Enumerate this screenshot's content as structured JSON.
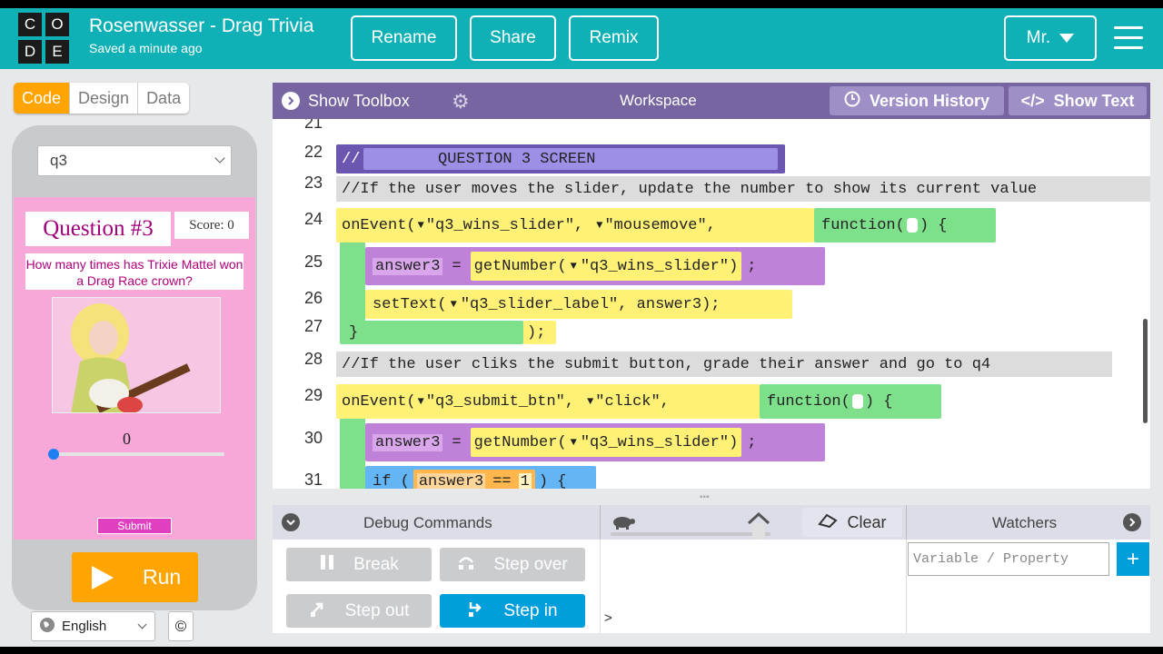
{
  "header": {
    "logo_letters": [
      "C",
      "O",
      "D",
      "E"
    ],
    "project_title": "Rosenwasser - Drag Trivia",
    "saved_status": "Saved a minute ago",
    "rename_label": "Rename",
    "share_label": "Share",
    "remix_label": "Remix",
    "user_label": "Mr.",
    "menu_icon": "hamburger-menu-icon"
  },
  "mode_tabs": [
    "Code",
    "Design",
    "Data"
  ],
  "active_tab": "Code",
  "app_preview": {
    "screen_select": "q3",
    "question_title": "Question #3",
    "score": "Score: 0",
    "question_text": "How many times has Trixie Mattel won a Drag Race crown?",
    "slider_value": "0",
    "submit_label": "Submit",
    "run_label": "Run",
    "language": "English",
    "copyright": "©"
  },
  "workspace": {
    "show_toolbox": "Show Toolbox",
    "title": "Workspace",
    "version_history": "Version History",
    "show_text": "Show Text",
    "line_numbers": [
      "21",
      "22",
      "23",
      "24",
      "25",
      "26",
      "27",
      "28",
      "29",
      "30",
      "31"
    ],
    "code": {
      "l22_comment": "//",
      "l22_banner": "        QUESTION 3 SCREEN",
      "l23_comment": "//If the user moves the slider, update the number to show its current value",
      "l24_onevent": "onEvent(",
      "l24_arg1": "\"q3_wins_slider\",",
      "l24_arg2": "\"mousemove\",",
      "l24_func": "function(",
      "l24_close": ") {",
      "l25_var": "answer3",
      "l25_eq": "=",
      "l25_call": "getNumber(",
      "l25_arg": "\"q3_wins_slider\")",
      "l25_semi": ";",
      "l26_call": "setText(",
      "l26_args": "\"q3_slider_label\", answer3);",
      "l27_close": "}",
      "l27_end": ");",
      "l28_comment": "//If the user cliks the submit button, grade their answer and go to q4",
      "l29_onevent": "onEvent(",
      "l29_arg1": "\"q3_submit_btn\",",
      "l29_arg2": "\"click\",",
      "l29_func": "function(",
      "l29_close": ") {",
      "l30_var": "answer3",
      "l30_eq": "=",
      "l30_call": "getNumber(",
      "l30_arg": "\"q3_wins_slider\")",
      "l30_semi": ";",
      "l31_if": "if (",
      "l31_var": "answer3",
      "l31_op": "==",
      "l31_num": "1",
      "l31_close": ") {"
    }
  },
  "debug": {
    "title": "Debug Commands",
    "break": "Break",
    "step_over": "Step over",
    "step_out": "Step out",
    "step_in": "Step in",
    "clear": "Clear",
    "console_prompt": ">",
    "watchers": "Watchers",
    "watch_placeholder": "Variable / Property",
    "add": "+"
  },
  "colors": {
    "header_bg": "#0fb1b7",
    "accent_orange": "#ffa400",
    "workspace_bar": "#7665a0",
    "event_yellow": "#fff176",
    "function_green": "#7fe08c",
    "variable_purple": "#c081d9",
    "debug_blue": "#009eda"
  }
}
